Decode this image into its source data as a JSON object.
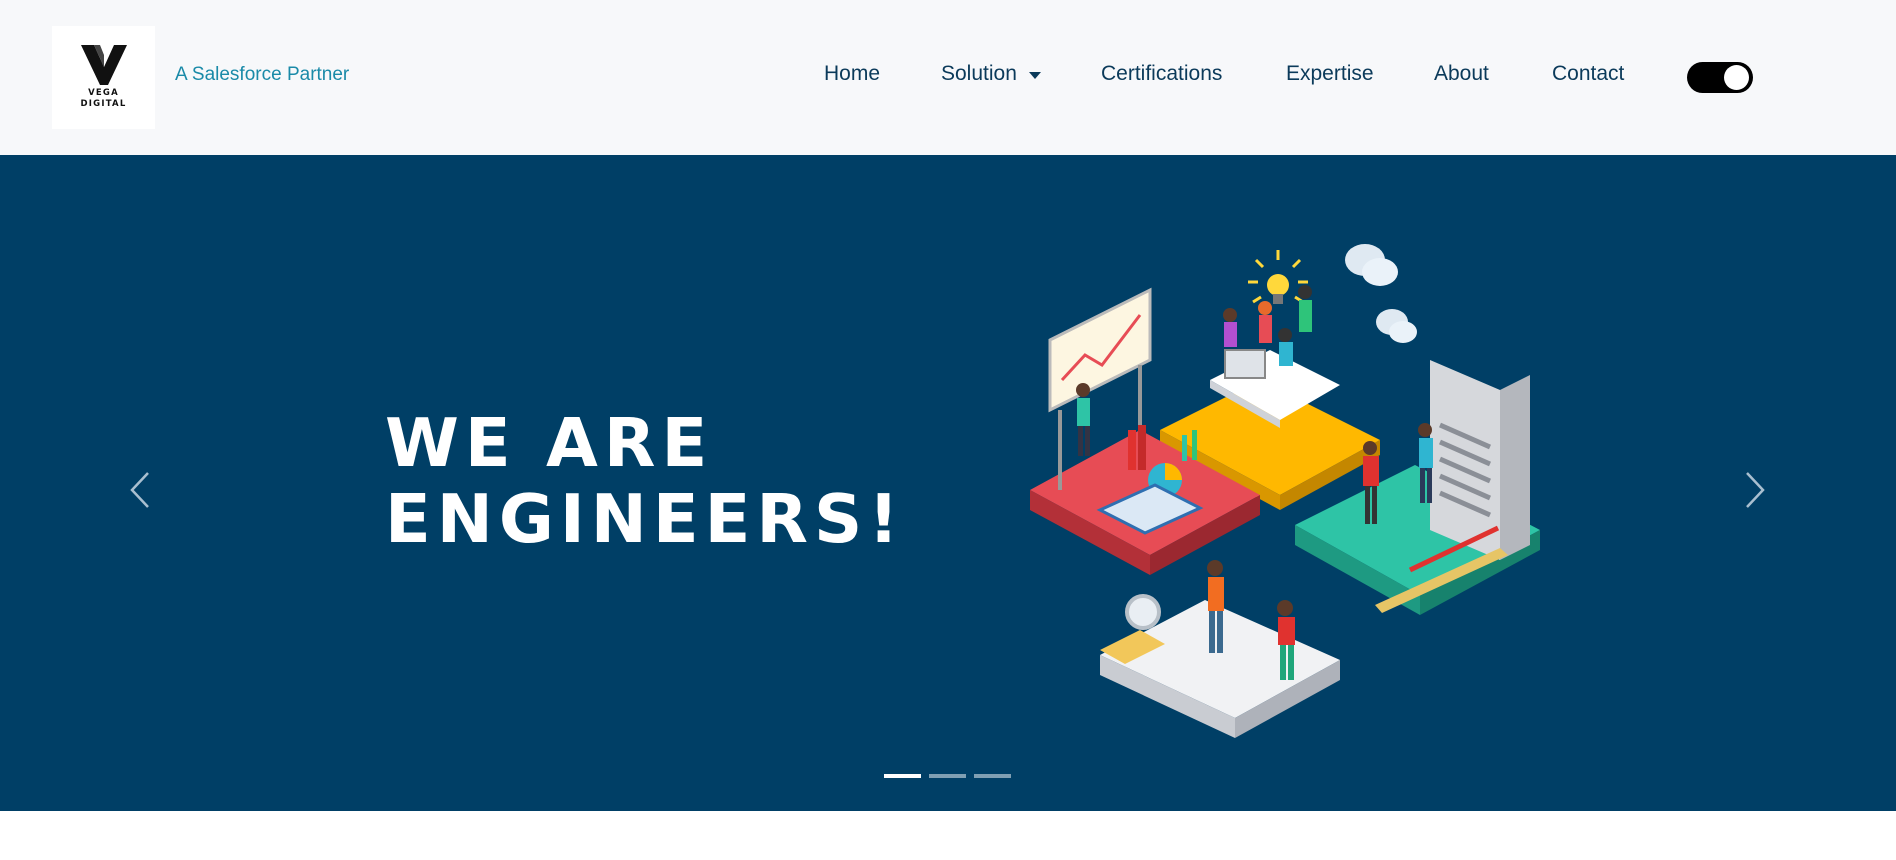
{
  "brand": {
    "logo_line1": "VEGA",
    "logo_line2": "DIGITAL",
    "tagline": "A Salesforce Partner"
  },
  "nav": {
    "items": [
      {
        "label": "Home"
      },
      {
        "label": "Solution",
        "has_dropdown": true
      },
      {
        "label": "Certifications"
      },
      {
        "label": "Expertise"
      },
      {
        "label": "About"
      },
      {
        "label": "Contact"
      }
    ],
    "theme_toggle": {
      "state": "on"
    }
  },
  "hero": {
    "headline_line1": "WE ARE",
    "headline_line2": "ENGINEERS!",
    "background_color": "#003f66",
    "prev_icon": "chevron-left-icon",
    "next_icon": "chevron-right-icon",
    "slide_indicators": 3,
    "active_slide": 1,
    "illustration": "isometric-team-puzzle-illustration"
  },
  "colors": {
    "accent": "#1a8aa8",
    "nav_text": "#0b3a5a",
    "hero_bg": "#003f66"
  }
}
